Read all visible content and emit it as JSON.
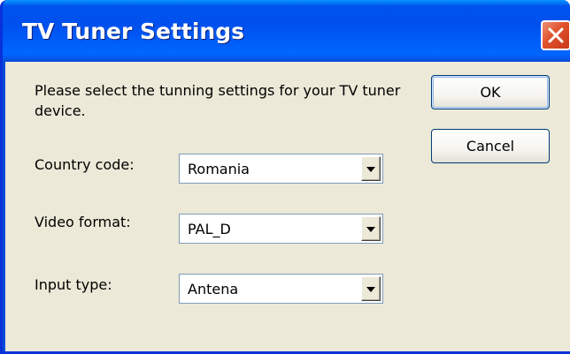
{
  "window": {
    "title": "TV Tuner Settings"
  },
  "dialog": {
    "instructions": "Please select the tunning settings for your TV tuner device.",
    "fields": {
      "country": {
        "label": "Country code:",
        "value": "Romania"
      },
      "video_format": {
        "label": "Video format:",
        "value": "PAL_D"
      },
      "input_type": {
        "label": "Input type:",
        "value": "Antena"
      }
    },
    "buttons": {
      "ok_label": "OK",
      "cancel_label": "Cancel"
    }
  },
  "icons": {
    "close": "close-icon",
    "dropdown": "chevron-down-icon"
  },
  "colors": {
    "titlebar_blue": "#0053ee",
    "client_background": "#ece9d8",
    "close_red": "#e0502b",
    "field_border": "#7f9db9"
  }
}
